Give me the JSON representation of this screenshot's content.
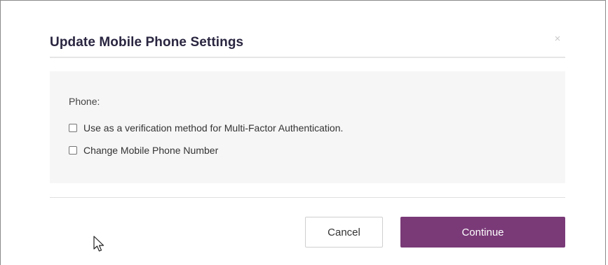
{
  "dialog": {
    "title": "Update Mobile Phone Settings",
    "close_glyph": "×",
    "phone_label": "Phone:",
    "options": [
      {
        "label": "Use as a verification method for Multi-Factor Authentication.",
        "checked": false
      },
      {
        "label": "Change Mobile Phone Number",
        "checked": false
      }
    ],
    "buttons": {
      "cancel": "Cancel",
      "continue": "Continue"
    }
  },
  "colors": {
    "primary": "#7a3a78",
    "title": "#2a2540",
    "panel_bg": "#f6f6f6"
  },
  "icons": {
    "close": "close-icon",
    "cursor": "mouse-pointer-icon"
  }
}
